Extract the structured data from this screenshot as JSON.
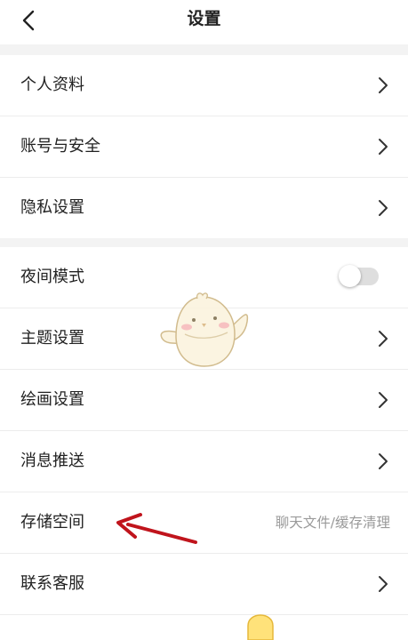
{
  "header": {
    "title": "设置",
    "back_icon": "chevron-left-icon"
  },
  "settings": {
    "profile": "个人资料",
    "account_security": "账号与安全",
    "privacy": "隐私设置",
    "night_mode": "夜间模式",
    "night_mode_enabled": false,
    "theme": "主题设置",
    "drawing": "绘画设置",
    "notifications": "消息推送",
    "storage": "存储空间",
    "storage_hint": "聊天文件/缓存清理",
    "customer_service": "联系客服"
  },
  "colors": {
    "background": "#ffffff",
    "section_gap": "#f3f3f3",
    "text": "#222222",
    "hint_text": "#9a9a9a",
    "toggle_off": "#dedede",
    "annotation_arrow": "#c0141c"
  }
}
